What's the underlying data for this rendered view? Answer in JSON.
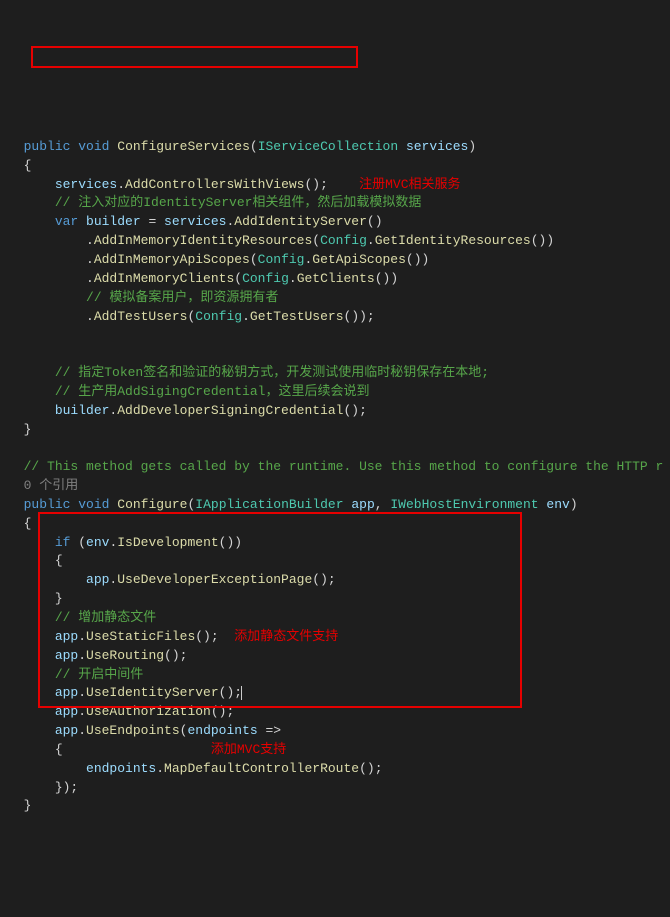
{
  "l1_public": "public",
  "l1_void": "void",
  "l1_method": "ConfigureServices",
  "l1_type": "IServiceCollection",
  "l1_param": "services",
  "l2": "{",
  "l3_obj": "services",
  "l3_m": "AddControllersWithViews",
  "l3_lbl": "注册MVC相关服务",
  "l4": "// 注入对应的IdentityServer相关组件，然后加载模拟数据",
  "l5_var": "var",
  "l5_name": "builder",
  "l5_obj": "services",
  "l5_m": "AddIdentityServer",
  "l6_m": "AddInMemoryIdentityResources",
  "l6_cfg": "Config",
  "l6_m2": "GetIdentityResources",
  "l7_m": "AddInMemoryApiScopes",
  "l7_m2": "GetApiScopes",
  "l8_m": "AddInMemoryClients",
  "l8_m2": "GetClients",
  "l9": "// 模拟备案用户，即资源拥有者",
  "l10_m": "AddTestUsers",
  "l10_m2": "GetTestUsers",
  "l12": "// 指定Token签名和验证的秘钥方式，开发测试使用临时秘钥保存在本地;",
  "l13": "// 生产用AddSigingCredential，这里后续会说到",
  "l14_obj": "builder",
  "l14_m": "AddDeveloperSigningCredential",
  "l15": "}",
  "l17": "// This method gets called by the runtime. Use this method to configure the HTTP r",
  "l18": "0 个引用",
  "l19_public": "public",
  "l19_void": "void",
  "l19_method": "Configure",
  "l19_t1": "IApplicationBuilder",
  "l19_p1": "app",
  "l19_t2": "IWebHostEnvironment",
  "l19_p2": "env",
  "l20": "{",
  "l21_if": "if",
  "l21_obj": "env",
  "l21_m": "IsDevelopment",
  "l22": "{",
  "l23_obj": "app",
  "l23_m": "UseDeveloperExceptionPage",
  "l24": "}",
  "l25": "// 增加静态文件",
  "l26_obj": "app",
  "l26_m": "UseStaticFiles",
  "l26_lbl": "添加静态文件支持",
  "l27_obj": "app",
  "l27_m": "UseRouting",
  "l28": "// 开启中间件",
  "l29_obj": "app",
  "l29_m": "UseIdentityServer",
  "l30_obj": "app",
  "l30_m": "UseAuthorization",
  "l31_obj": "app",
  "l31_m": "UseEndpoints",
  "l31_p": "endpoints",
  "l32": "{",
  "l32_lbl": "添加MVC支持",
  "l33_obj": "endpoints",
  "l33_m": "MapDefaultControllerRoute",
  "l34": "});"
}
